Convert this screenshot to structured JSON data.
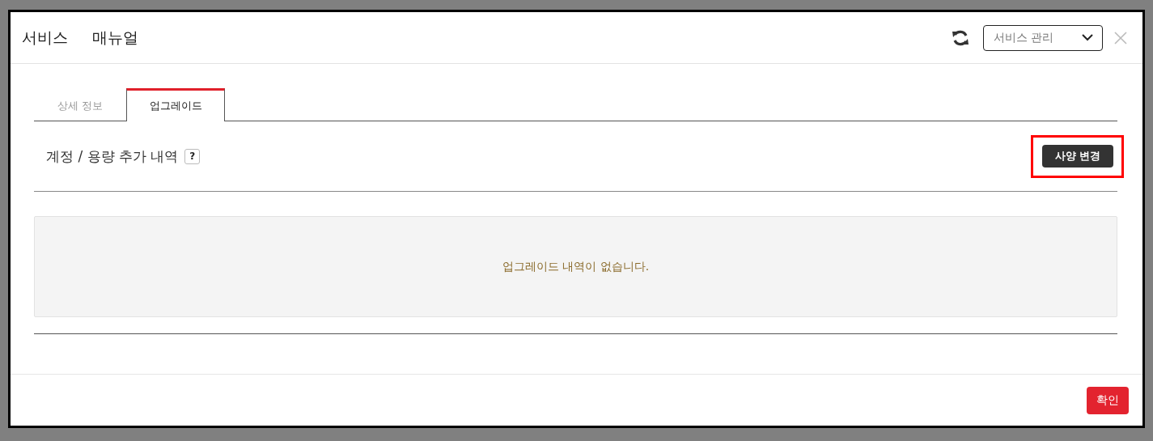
{
  "modal": {
    "header_tabs": [
      {
        "label": "서비스"
      },
      {
        "label": "매뉴얼"
      }
    ],
    "service_select": {
      "value": "서비스 관리"
    },
    "tabs": [
      {
        "label": "상세 정보",
        "selected": false
      },
      {
        "label": "업그레이드",
        "selected": true
      }
    ],
    "section": {
      "title": "계정 / 용량 추가 내역",
      "help": "?",
      "button": {
        "label": "사양 변경",
        "highlighted": true
      }
    },
    "empty_message": "업그레이드 내역이 없습니다.",
    "footer": {
      "confirm": "확인"
    }
  }
}
